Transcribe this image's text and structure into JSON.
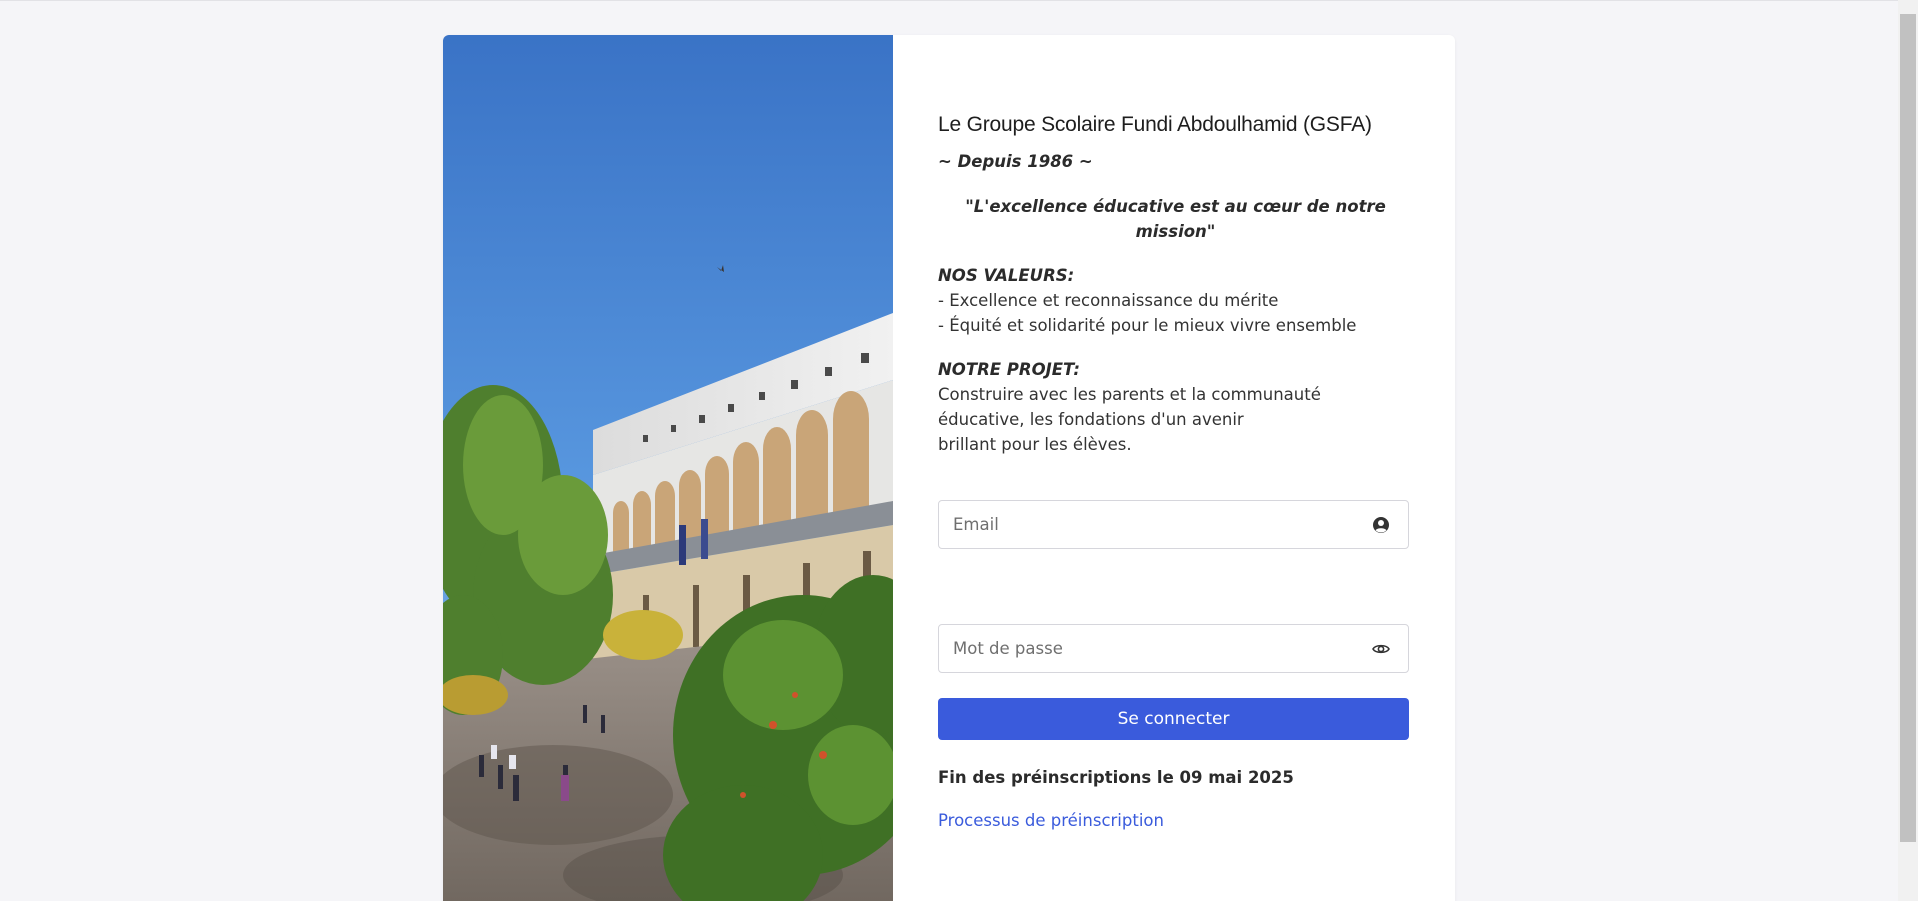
{
  "school": {
    "title": "Le Groupe Scolaire Fundi Abdoulhamid (GSFA)",
    "since": "~ Depuis 1986 ~",
    "motto": "\"L'excellence éducative est au cœur de notre mission\""
  },
  "values": {
    "heading": "NOS VALEURS:",
    "items": [
      "- Excellence et reconnaissance du mérite",
      "- Équité et solidarité pour le mieux vivre ensemble"
    ]
  },
  "project": {
    "heading": "NOTRE PROJET:",
    "lines": [
      "Construire avec les parents et la communauté",
      "éducative, les fondations d'un avenir",
      "brillant pour les élèves."
    ]
  },
  "form": {
    "email_placeholder": "Email",
    "email_icon": "user-circle-icon",
    "password_placeholder": "Mot de passe",
    "password_icon": "eye-icon",
    "submit_label": "Se connecter"
  },
  "deadline": "Fin des préinscriptions le 09 mai 2025",
  "process_link": "Processus de préinscription",
  "colors": {
    "primary": "#3a5bdc",
    "background": "#f5f5f8",
    "card": "#ffffff"
  }
}
